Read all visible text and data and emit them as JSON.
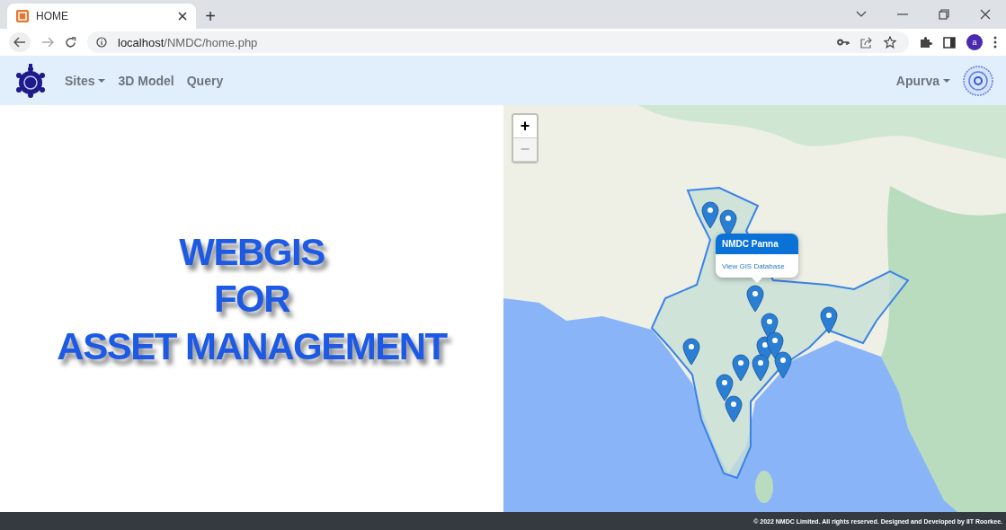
{
  "browser": {
    "tabs": [
      {
        "title": "HOME",
        "selected": true
      }
    ],
    "new_tab": "+",
    "url_host": "localhost",
    "url_path": "/NMDC/home.php",
    "profile_initial": "a"
  },
  "navbar": {
    "items": [
      {
        "label": "Sites",
        "dropdown": true
      },
      {
        "label": "3D Model",
        "dropdown": false
      },
      {
        "label": "Query",
        "dropdown": false
      }
    ],
    "user": {
      "label": "Apurva",
      "dropdown": true
    }
  },
  "hero": {
    "lines": [
      "WEBGIS",
      "FOR",
      "ASSET MANAGEMENT"
    ]
  },
  "map": {
    "zoom_controls": [
      {
        "label": "+",
        "disabled": false
      },
      {
        "label": "−",
        "disabled": true
      }
    ],
    "popup": {
      "title": "NMDC Panna",
      "link": "View GIS Database"
    }
  },
  "footer": {
    "text": "© 2022 NMDC Limited. All rights reserved. Designed and Developed by IIT Roorkee."
  }
}
